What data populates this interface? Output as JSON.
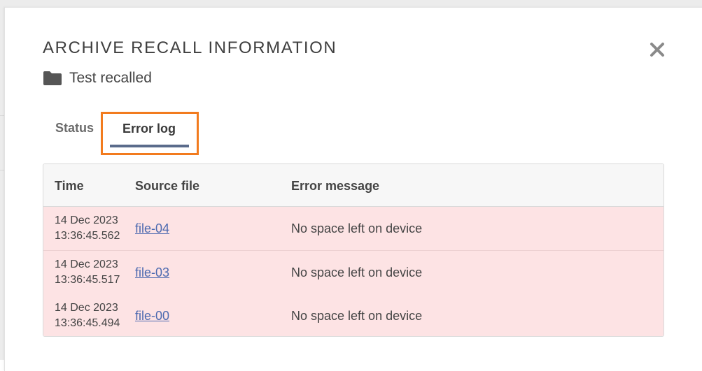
{
  "modal": {
    "title": "ARCHIVE RECALL INFORMATION",
    "subtitle": "Test recalled"
  },
  "icons": {
    "folder": "folder-icon",
    "close": "close-icon"
  },
  "tabs": [
    {
      "label": "Status",
      "active": false
    },
    {
      "label": "Error log",
      "active": true
    }
  ],
  "table": {
    "headers": [
      "Time",
      "Source file",
      "Error message"
    ],
    "rows": [
      {
        "date": "14 Dec 2023",
        "time": "13:36:45.562",
        "file": "file-04",
        "message": "No space left on device"
      },
      {
        "date": "14 Dec 2023",
        "time": "13:36:45.517",
        "file": "file-03",
        "message": "No space left on device"
      },
      {
        "date": "14 Dec 2023",
        "time": "13:36:45.494",
        "file": "file-00",
        "message": "No space left on device"
      }
    ]
  },
  "colors": {
    "highlight": "#f27b1e",
    "tab_underline": "#5a6b8b",
    "error_row": "#fde3e4",
    "link": "#4d6ab0"
  }
}
